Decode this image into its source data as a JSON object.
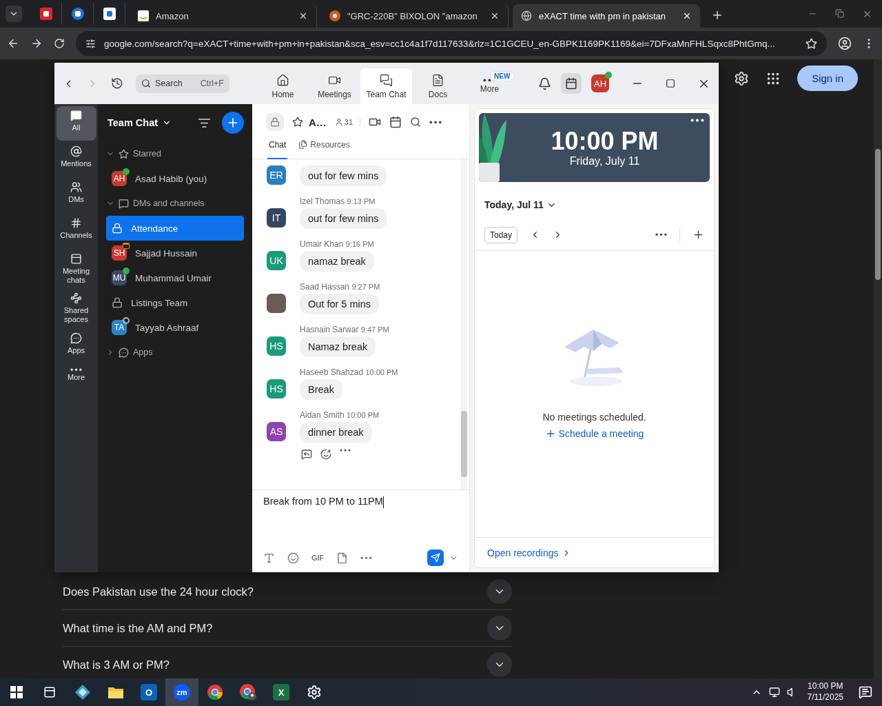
{
  "browser": {
    "tabs": [
      {
        "label": "Amazon",
        "selected": false
      },
      {
        "label": "\"GRC-220B\" BIXOLON \"amazon",
        "selected": false
      },
      {
        "label": "eXACT time with pm in pakistan",
        "selected": true
      }
    ],
    "address": "google.com/search?q=eXACT+time+with+pm+in+pakistan&sca_esv=cc1c4a1f7d117633&rlz=1C1GCEU_en-GBPK1169PK1169&ei=7DFxaMnFHLSqxc8PhtGmq..."
  },
  "google": {
    "sign_in": "Sign in",
    "faqs": [
      {
        "question": "Does Pakistan use the 24 hour clock?",
        "expanded": false
      },
      {
        "question": "What time is the AM and PM?",
        "expanded": false
      },
      {
        "question": "What is 3 AM or PM?",
        "expanded": false
      }
    ]
  },
  "zoom": {
    "search": {
      "placeholder": "Search",
      "shortcut": "Ctrl+F"
    },
    "nav_tabs": [
      {
        "label": "Home",
        "selected": false
      },
      {
        "label": "Meetings",
        "selected": false
      },
      {
        "label": "Team Chat",
        "selected": true
      },
      {
        "label": "Docs",
        "selected": false
      },
      {
        "label": "More",
        "selected": false,
        "badge": "NEW"
      }
    ],
    "profile": {
      "initials": "AH",
      "online": true
    },
    "rail": [
      {
        "label": "All",
        "selected": true
      },
      {
        "label": "Mentions",
        "selected": false
      },
      {
        "label": "DMs",
        "selected": false
      },
      {
        "label": "Channels",
        "selected": false
      },
      {
        "label": "Meeting chats",
        "selected": false
      },
      {
        "label": "Shared spaces",
        "selected": false
      },
      {
        "label": "Apps",
        "selected": false
      },
      {
        "label": "More",
        "selected": false
      }
    ],
    "sidebar": {
      "title": "Team Chat",
      "sections": [
        {
          "kind": "starred",
          "label": "Starred",
          "expanded": true,
          "items": [
            {
              "kind": "person",
              "name": "Asad Habib (you)",
              "initials": "AH",
              "color": "#c8392f",
              "online": true,
              "selected": false
            }
          ]
        },
        {
          "kind": "chats",
          "label": "DMs and channels",
          "expanded": true,
          "items": [
            {
              "kind": "channel",
              "name": "Attendance",
              "selected": true
            },
            {
              "kind": "person",
              "name": "Sajjad Hussain",
              "initials": "SH",
              "color": "#c8392f",
              "in_meeting": true,
              "selected": false
            },
            {
              "kind": "person",
              "name": "Muhammad Umair",
              "initials": "MU",
              "color": "#3a4b63",
              "online": true,
              "selected": false
            },
            {
              "kind": "channel",
              "name": "Listings Team",
              "selected": false
            },
            {
              "kind": "person",
              "name": "Tayyab Ashraaf",
              "initials": "TA",
              "color": "#2a84c6",
              "online": false,
              "selected": false
            }
          ]
        },
        {
          "kind": "apps",
          "label": "Apps",
          "expanded": false
        }
      ]
    },
    "channel": {
      "title": "A…",
      "members": "31",
      "tabs": [
        {
          "label": "Chat",
          "selected": true
        },
        {
          "label": "Resources",
          "selected": false
        }
      ]
    },
    "messages": [
      {
        "kind": "initials",
        "initials": "ER",
        "color": "#2a7fbf",
        "text": "out for few mins"
      },
      {
        "kind": "initials",
        "sender": "Izel Thomas",
        "time": "9:13 PM",
        "initials": "IT",
        "color": "#34475f",
        "text": "out for few mins"
      },
      {
        "kind": "initials",
        "sender": "Umair Khan",
        "time": "9:16 PM",
        "initials": "UK",
        "color": "#1a9b7a",
        "text": "namaz break"
      },
      {
        "kind": "photo",
        "sender": "Saad Hassan",
        "time": "9:27 PM",
        "text": "Out for 5 mins"
      },
      {
        "kind": "initials",
        "sender": "Hasnain Sarwar",
        "time": "9:47 PM",
        "initials": "HS",
        "color": "#1a9b7a",
        "text": "Namaz break"
      },
      {
        "kind": "initials",
        "sender": "Haseeb Shahzad",
        "time": "10:00 PM",
        "initials": "HS",
        "color": "#1a9b7a",
        "text": "Break"
      },
      {
        "kind": "initials",
        "sender": "Aidan Smith",
        "time": "10:00 PM",
        "initials": "AS",
        "color": "#8e44ad",
        "text": "dinner break"
      }
    ],
    "composer": {
      "value": "Break from 10 PM to 11PM",
      "gif": "GIF"
    },
    "calendar": {
      "time": "10:00 PM",
      "date": "Friday, July 11",
      "day_label": "Today, Jul 11",
      "today_button": "Today",
      "empty": "No meetings scheduled.",
      "schedule": "Schedule a meeting",
      "recordings": "Open recordings"
    }
  },
  "taskbar": {
    "apps": [
      {
        "kind": "diamond",
        "active": false
      },
      {
        "kind": "folder",
        "active": false
      },
      {
        "kind": "outlook",
        "label": "O",
        "active": false
      },
      {
        "kind": "zoom",
        "label": "zm",
        "active": true
      },
      {
        "kind": "chrome",
        "active": false
      },
      {
        "kind": "chrome-profile",
        "active": false
      },
      {
        "kind": "excel",
        "label": "X",
        "active": false
      },
      {
        "kind": "settings",
        "active": false
      }
    ],
    "time": "10:00 PM",
    "date": "7/11/2025"
  }
}
